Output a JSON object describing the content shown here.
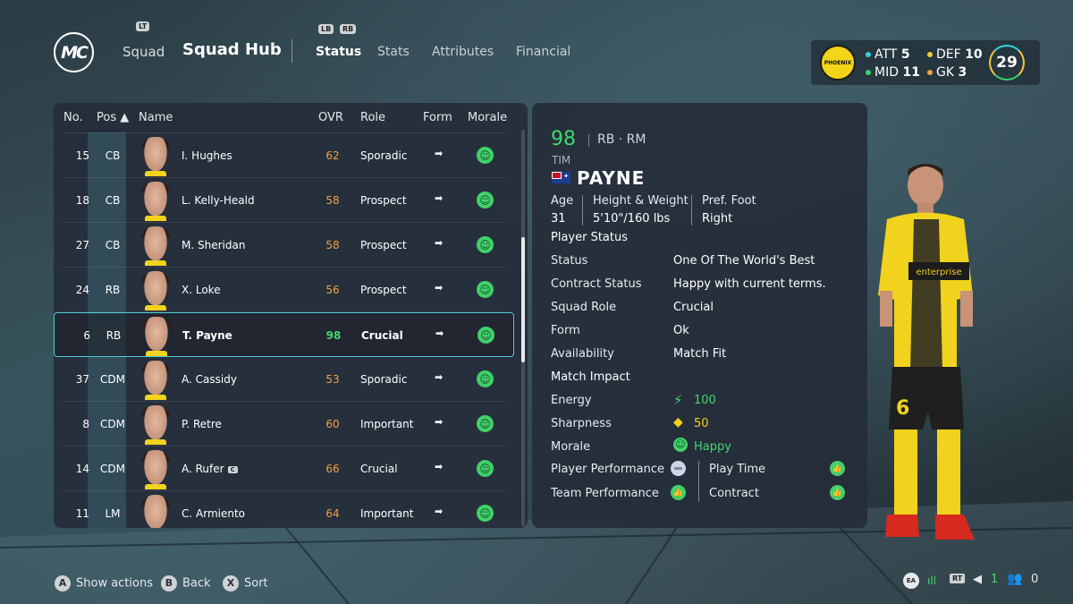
{
  "nav": {
    "lt_badge": "LT",
    "squad": "Squad",
    "current": "Squad Hub",
    "lb_badge": "LB",
    "rb_badge": "RB",
    "tabs": [
      "Status",
      "Stats",
      "Attributes",
      "Financial"
    ],
    "logo_text": "MC"
  },
  "team": {
    "crest_text": "PHOENIX",
    "att_label": "ATT",
    "att": "5",
    "def_label": "DEF",
    "def": "10",
    "mid_label": "MID",
    "mid": "11",
    "gk_label": "GK",
    "gk": "3",
    "overall": "29",
    "colors": {
      "att": "#39d0e0",
      "def": "#f4c93a",
      "mid": "#3bd16f",
      "gk": "#f4a23a"
    }
  },
  "list": {
    "headers": {
      "no": "No.",
      "pos": "Pos ▲",
      "name": "Name",
      "ovr": "OVR",
      "role": "Role",
      "form": "Form",
      "morale": "Morale"
    },
    "rows": [
      {
        "no": "15",
        "pos": "CB",
        "name": "I. Hughes",
        "ovr": "62",
        "role": "Sporadic",
        "form": "➡",
        "morale": "☺"
      },
      {
        "no": "18",
        "pos": "CB",
        "name": "L. Kelly-Heald",
        "ovr": "58",
        "role": "Prospect",
        "form": "➡",
        "morale": "☺"
      },
      {
        "no": "27",
        "pos": "CB",
        "name": "M. Sheridan",
        "ovr": "58",
        "role": "Prospect",
        "form": "➡",
        "morale": "☺"
      },
      {
        "no": "24",
        "pos": "RB",
        "name": "X. Loke",
        "ovr": "56",
        "role": "Prospect",
        "form": "➡",
        "morale": "☺"
      },
      {
        "no": "6",
        "pos": "RB",
        "name": "T. Payne",
        "ovr": "98",
        "role": "Crucial",
        "form": "➡",
        "morale": "☺"
      },
      {
        "no": "37",
        "pos": "CDM",
        "name": "A. Cassidy",
        "ovr": "53",
        "role": "Sporadic",
        "form": "➡",
        "morale": "☺"
      },
      {
        "no": "8",
        "pos": "CDM",
        "name": "P. Retre",
        "ovr": "60",
        "role": "Important",
        "form": "➡",
        "morale": "☺"
      },
      {
        "no": "14",
        "pos": "CDM",
        "name": "A. Rufer",
        "ovr": "66",
        "role": "Crucial",
        "form": "➡",
        "morale": "☺",
        "captain": "C"
      },
      {
        "no": "11",
        "pos": "LM",
        "name": "C. Armiento",
        "ovr": "64",
        "role": "Important",
        "form": "➡",
        "morale": "☺"
      }
    ]
  },
  "player": {
    "rating": "98",
    "positions": "RB · RM",
    "first_name": "TIM",
    "surname": "PAYNE",
    "age_label": "Age",
    "age": "31",
    "hw_label": "Height & Weight",
    "hw": "5'10\"/160 lbs",
    "foot_label": "Pref. Foot",
    "foot": "Right",
    "player_status_heading": "Player Status",
    "status_label": "Status",
    "status": "One Of The World's Best",
    "contract_label": "Contract Status",
    "contract": "Happy with current terms.",
    "role_label": "Squad Role",
    "role": "Crucial",
    "form_label": "Form",
    "form": "Ok",
    "avail_label": "Availability",
    "avail": "Match Fit",
    "impact_heading": "Match Impact",
    "energy_label": "Energy",
    "energy": "100",
    "sharp_label": "Sharpness",
    "sharp": "50",
    "morale_label": "Morale",
    "morale": "Happy",
    "pperf_label": "Player Performance",
    "tperf_label": "Team Performance",
    "playtime_label": "Play Time",
    "contract2_label": "Contract",
    "shirt_number": "6",
    "sponsor": "enterprise"
  },
  "footer": {
    "a_glyph": "A",
    "a_label": "Show actions",
    "b_glyph": "B",
    "b_label": "Back",
    "x_glyph": "X",
    "x_label": "Sort",
    "ea": "EA",
    "rt": "RT",
    "friends_count": "1",
    "party_count": "0"
  }
}
